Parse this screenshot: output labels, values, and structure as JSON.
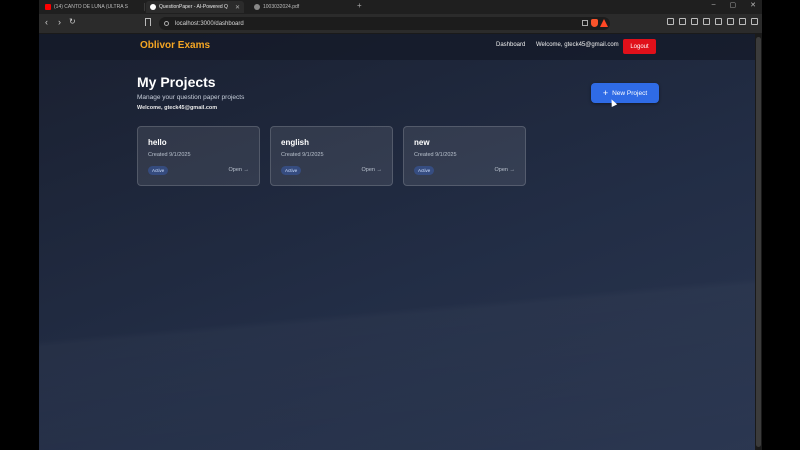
{
  "browser": {
    "tabs": [
      {
        "label": "(14) CANTO DE LUNA (ULTRA S",
        "active": false,
        "favicon_color": "#ff0000"
      },
      {
        "label": "QuestionPaper - AI-Powered Q",
        "active": true,
        "favicon_color": "#ffffff"
      },
      {
        "label": "1003032024.pdf",
        "active": false,
        "favicon_color": "#888888"
      }
    ],
    "new_tab": "+",
    "window_buttons": [
      "–",
      "▢",
      "✕"
    ],
    "address": "localhost:3000/dashboard"
  },
  "navbar": {
    "brand": "Oblivor Exams",
    "links": {
      "dashboard": "Dashboard",
      "welcome": "Welcome, gteck45@gmail.com"
    },
    "logout": "Logout"
  },
  "header": {
    "title": "My Projects",
    "subtitle": "Manage your question paper projects",
    "welcome": "Welcome, gteck45@gmail.com",
    "new_project": "New Project"
  },
  "projects": [
    {
      "name": "hello",
      "created": "Created 9/1/2025",
      "status": "Active",
      "open": "Open →"
    },
    {
      "name": "english",
      "created": "Created 9/1/2025",
      "status": "Active",
      "open": "Open →"
    },
    {
      "name": "new",
      "created": "Created 9/1/2025",
      "status": "Active",
      "open": "Open →"
    }
  ],
  "colors": {
    "brand": "#f5a623",
    "logout": "#e0101a",
    "primary": "#2f6be6"
  }
}
